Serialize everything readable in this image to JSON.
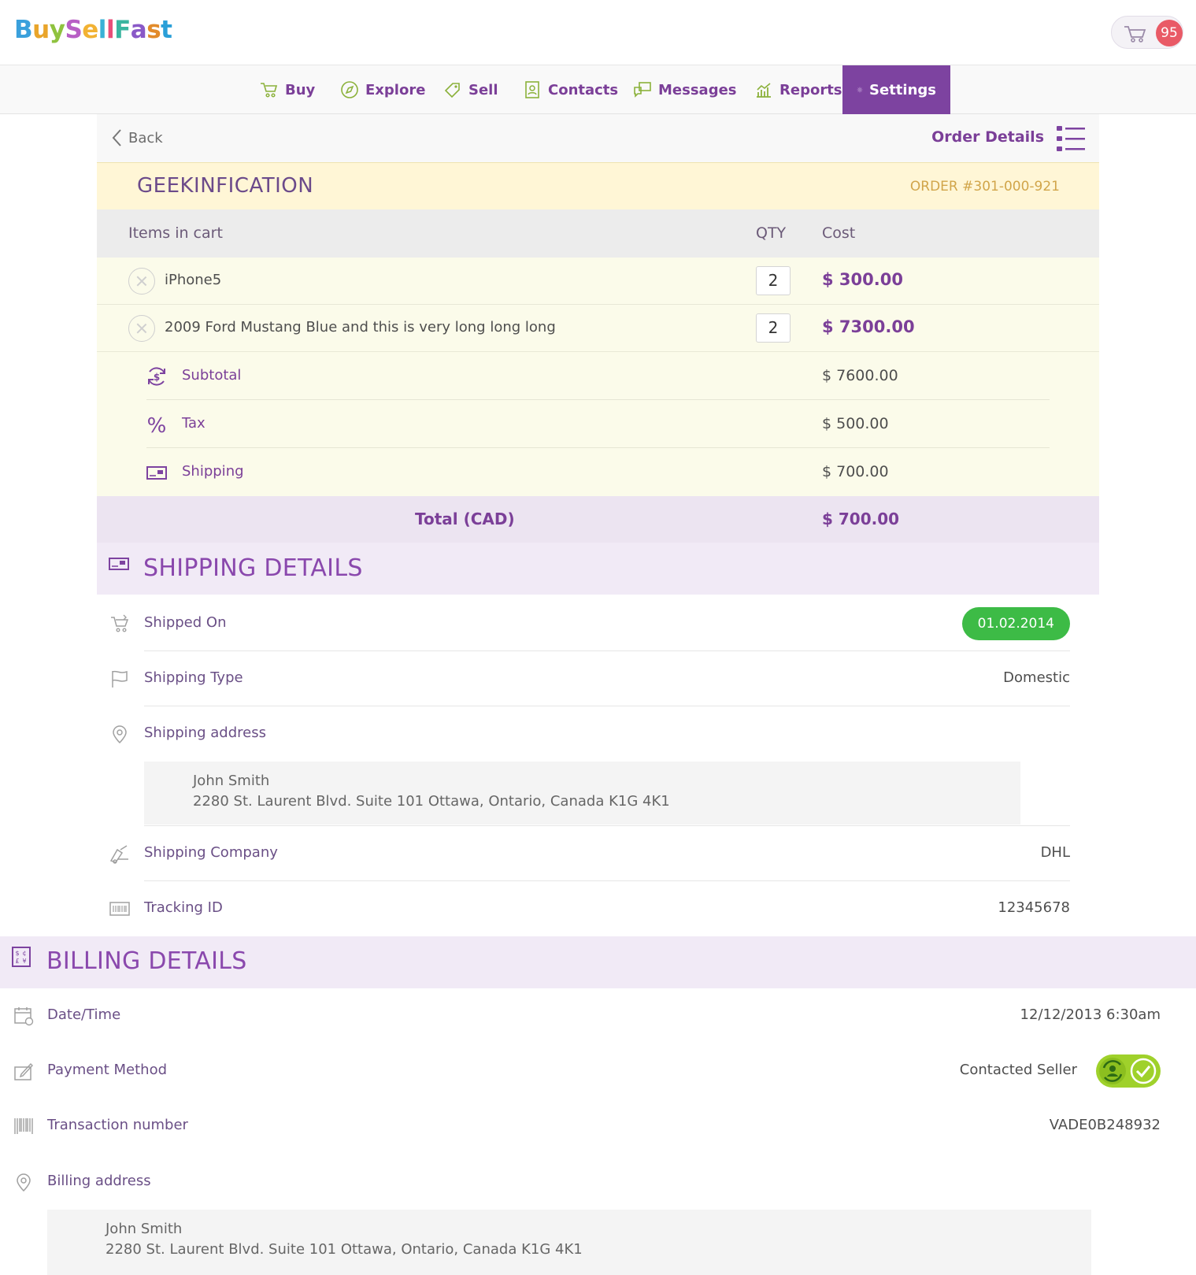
{
  "brand": {
    "logo_text": "BuySellFast",
    "cart_count": "95"
  },
  "nav": {
    "items": [
      {
        "label": "Buy",
        "icon": "cart-icon"
      },
      {
        "label": "Explore",
        "icon": "compass-icon"
      },
      {
        "label": "Sell",
        "icon": "tag-icon"
      },
      {
        "label": "Contacts",
        "icon": "contacts-icon"
      },
      {
        "label": "Messages",
        "icon": "messages-icon"
      },
      {
        "label": "Reports",
        "icon": "reports-icon"
      },
      {
        "label": "Settings",
        "icon": "gear-icon"
      }
    ],
    "active": "Settings"
  },
  "topbar": {
    "back_label": "Back",
    "title": "Order Details"
  },
  "order": {
    "store_name": "GEEKINFICATION",
    "order_number": "ORDER #301-000-921",
    "headers": {
      "items": "Items in cart",
      "qty": "QTY",
      "cost": "Cost"
    },
    "items": [
      {
        "name": "iPhone5",
        "qty": "2",
        "cost": "$ 300.00"
      },
      {
        "name": "2009 Ford Mustang Blue and this is very long long long",
        "qty": "2",
        "cost": "$ 7300.00"
      }
    ],
    "summary": {
      "subtotal_label": "Subtotal",
      "subtotal": "$ 7600.00",
      "tax_label": "Tax",
      "tax": "$ 500.00",
      "shipping_label": "Shipping",
      "shipping": "$ 700.00"
    },
    "total_label": "Total (CAD)",
    "total": "$ 700.00"
  },
  "shipping": {
    "title": "SHIPPING DETAILS",
    "shipped_on_label": "Shipped On",
    "shipped_on": "01.02.2014",
    "type_label": "Shipping Type",
    "type": "Domestic",
    "address_label": "Shipping address",
    "address_name": "John Smith",
    "address_line": "2280 St. Laurent Blvd. Suite 101 Ottawa, Ontario, Canada K1G 4K1",
    "company_label": "Shipping Company",
    "company": "DHL",
    "tracking_label": "Tracking ID",
    "tracking": "12345678"
  },
  "billing": {
    "title": "BILLING DETAILS",
    "datetime_label": "Date/Time",
    "datetime": "12/12/2013 6:30am",
    "payment_label": "Payment Method",
    "payment": "Contacted Seller",
    "transaction_label": "Transaction number",
    "transaction": "VADE0B248932",
    "address_label": "Billing address",
    "address_name": "John Smith",
    "address_line": "2280 St. Laurent Blvd. Suite 101 Ottawa, Ontario, Canada K1G 4K1"
  },
  "colors": {
    "brand_purple": "#7d43a0",
    "success_green": "#3dbb46",
    "badge_red": "#e95a66",
    "store_bar": "#fff6d6"
  }
}
